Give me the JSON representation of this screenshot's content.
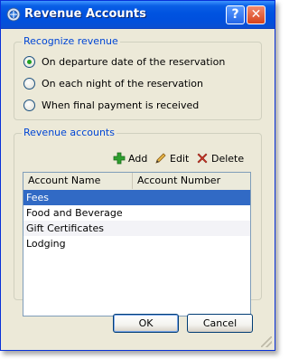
{
  "window": {
    "title": "Revenue Accounts",
    "help_symbol": "?",
    "close_symbol": "✕"
  },
  "recognize": {
    "group_title": "Recognize revenue",
    "options": [
      {
        "label": "On departure date of the reservation",
        "checked": true
      },
      {
        "label": "On each night of the reservation",
        "checked": false
      },
      {
        "label": "When final payment is received",
        "checked": false
      }
    ]
  },
  "accounts": {
    "group_title": "Revenue accounts",
    "add_label": "Add",
    "edit_label": "Edit",
    "delete_label": "Delete",
    "columns": [
      "Account Name",
      "Account Number"
    ],
    "rows": [
      "Fees",
      "Food and Beverage",
      "Gift Certificates",
      "Lodging"
    ],
    "selected_row": "Fees"
  },
  "buttons": {
    "ok_label": "OK",
    "cancel_label": "Cancel"
  },
  "icons": {
    "app": "gear-globe-icon",
    "add": "plus-icon",
    "edit": "pencil-icon",
    "delete": "red-x-icon"
  },
  "colors": {
    "titlebar": "#0053e0",
    "group_title": "#0046d5",
    "selection": "#316ac5",
    "add_icon": "#2e9f2e",
    "delete_icon": "#d23a2a"
  }
}
